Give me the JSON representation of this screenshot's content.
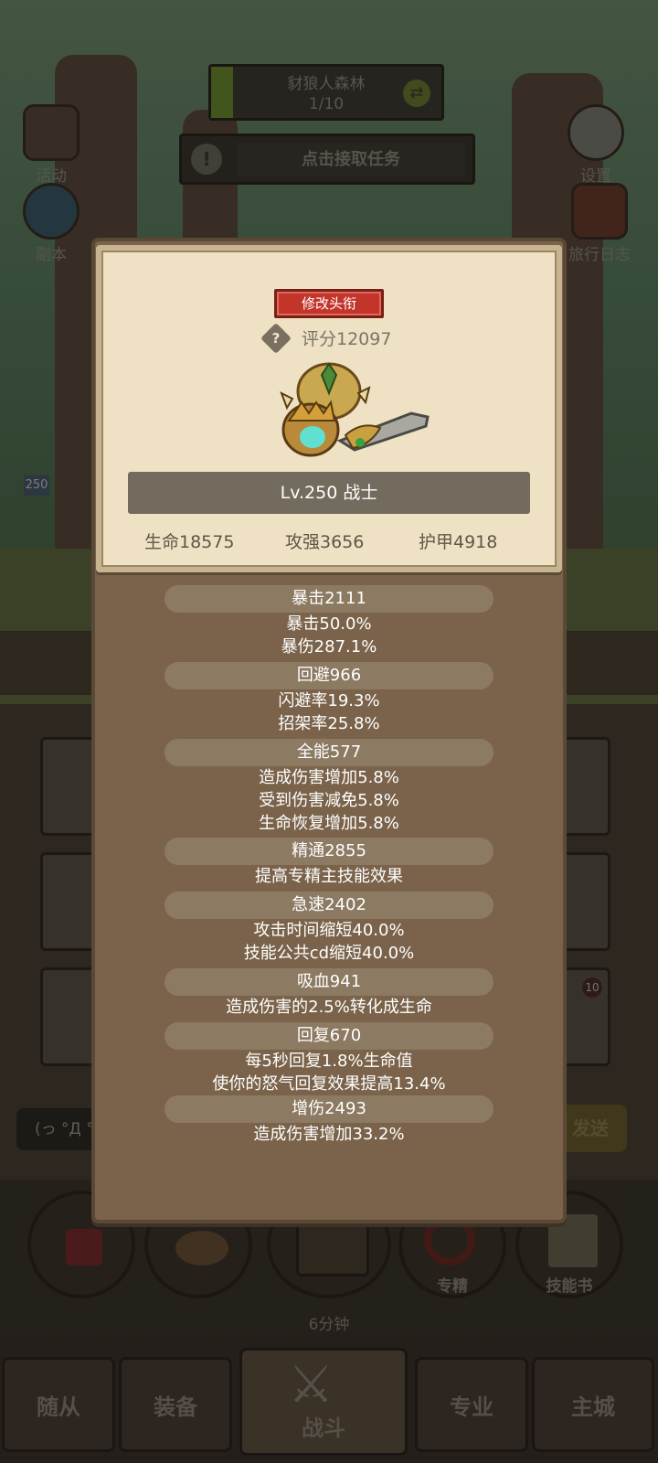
{
  "background": {
    "location_title": "豺狼人森林",
    "location_progress": "1/10",
    "quest_label": "点击接取任务",
    "left_icons": [
      {
        "label": "活动",
        "icon": "activity-board-icon"
      },
      {
        "label": "副本",
        "icon": "dungeon-portal-icon"
      }
    ],
    "right_icons": [
      {
        "label": "设置",
        "icon": "gear-icon"
      },
      {
        "label": "旅行日志",
        "icon": "journal-book-icon"
      }
    ],
    "chat_placeholder": "(っ °Д °",
    "send_label": "发送",
    "round_buttons": [
      {
        "label": "",
        "icon": "potion-icon"
      },
      {
        "label": "",
        "icon": "bread-icon"
      },
      {
        "label": "6分钟",
        "icon": "treasure-chest-icon"
      },
      {
        "label": "专精",
        "icon": "specialization-icon"
      },
      {
        "label": "技能书",
        "icon": "skill-book-icon"
      }
    ],
    "tabs": [
      "随从",
      "装备",
      "战斗",
      "专业",
      "主城"
    ],
    "left_unit_level": "250",
    "badge_count": "10"
  },
  "character": {
    "edit_title_label": "修改头衔",
    "score_label": "评分12097",
    "help_symbol": "?",
    "level_class": "Lv.250 战士",
    "base_stats": [
      "生命18575",
      "攻强3656",
      "护甲4918"
    ]
  },
  "stats": [
    {
      "title": "暴击2111",
      "lines": [
        "暴击50.0%",
        "暴伤287.1%"
      ]
    },
    {
      "title": "回避966",
      "lines": [
        "闪避率19.3%",
        "招架率25.8%"
      ]
    },
    {
      "title": "全能577",
      "lines": [
        "造成伤害增加5.8%",
        "受到伤害减免5.8%",
        "生命恢复增加5.8%"
      ]
    },
    {
      "title": "精通2855",
      "lines": [
        "提高专精主技能效果"
      ]
    },
    {
      "title": "急速2402",
      "lines": [
        "攻击时间缩短40.0%",
        "技能公共cd缩短40.0%"
      ]
    },
    {
      "title": "吸血941",
      "lines": [
        "造成伤害的2.5%转化成生命"
      ]
    },
    {
      "title": "回复670",
      "lines": [
        "每5秒回复1.8%生命值",
        "使你的怒气回复效果提高13.4%"
      ]
    },
    {
      "title": "增伤2493",
      "lines": [
        "造成伤害增加33.2%"
      ]
    }
  ],
  "colors": {
    "panel": "#7a634a",
    "card": "#efe2c4",
    "title_button": "#c3352b",
    "stat_header": "#8c7a62"
  }
}
